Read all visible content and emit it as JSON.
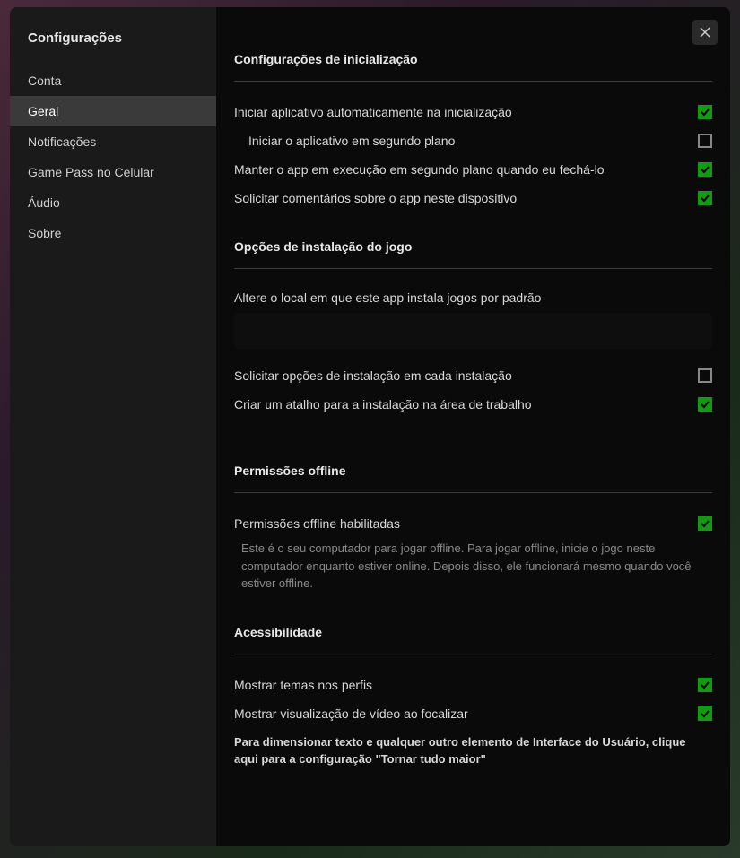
{
  "sidebar": {
    "title": "Configurações",
    "items": [
      {
        "label": "Conta"
      },
      {
        "label": "Geral"
      },
      {
        "label": "Notificações"
      },
      {
        "label": "Game Pass no Celular"
      },
      {
        "label": "Áudio"
      },
      {
        "label": "Sobre"
      }
    ],
    "activeIndex": 1
  },
  "sections": {
    "startup": {
      "header": "Configurações de inicialização",
      "autostart": {
        "label": "Iniciar aplicativo automaticamente na inicialização",
        "checked": true
      },
      "background_start": {
        "label": "Iniciar o aplicativo em segundo plano",
        "checked": false
      },
      "keep_running": {
        "label": "Manter o app em execução em segundo plano quando eu fechá-lo",
        "checked": true
      },
      "feedback": {
        "label": "Solicitar comentários sobre o app neste dispositivo",
        "checked": true
      }
    },
    "install": {
      "header": "Opções de instalação do jogo",
      "change_location": "Altere o local em que este app instala jogos por padrão",
      "ask_each": {
        "label": "Solicitar opções de instalação em cada instalação",
        "checked": false
      },
      "shortcut": {
        "label": "Criar um atalho para a instalação na área de trabalho",
        "checked": true
      }
    },
    "offline": {
      "header": "Permissões offline",
      "enabled": {
        "label": "Permissões offline habilitadas",
        "checked": true
      },
      "description": "Este é o seu computador para jogar offline. Para jogar offline, inicie o jogo neste computador enquanto estiver online. Depois disso, ele funcionará mesmo quando você estiver offline."
    },
    "accessibility": {
      "header": "Acessibilidade",
      "themes": {
        "label": "Mostrar temas nos perfis",
        "checked": true
      },
      "video_preview": {
        "label": "Mostrar visualização de vídeo ao focalizar",
        "checked": true
      },
      "note": "Para dimensionar texto e qualquer outro elemento de Interface do Usuário, clique aqui para a configuração \"Tornar tudo maior\""
    }
  }
}
